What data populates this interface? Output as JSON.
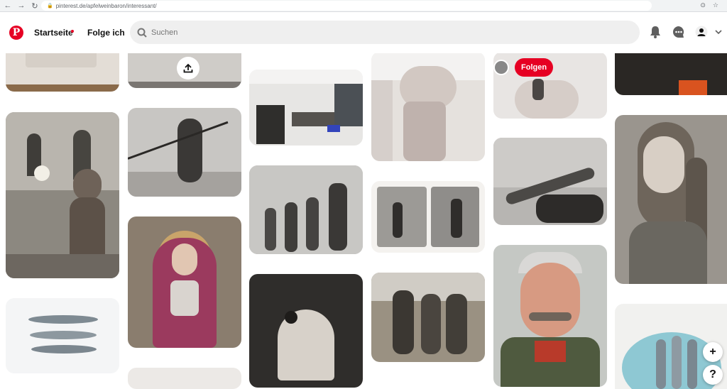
{
  "browser": {
    "url": "pinterest.de/apfelweinbaron/interessant/",
    "back_icon": "arrow-left-icon",
    "forward_icon": "arrow-right-icon",
    "reload_icon": "reload-icon"
  },
  "header": {
    "home_label": "Startseite",
    "following_label": "Folge ich",
    "search_placeholder": "Suchen"
  },
  "pin_overlay": {
    "follow_label": "Folgen"
  },
  "fabs": {
    "add_label": "+",
    "help_label": "?"
  },
  "colors": {
    "brand": "#e60023",
    "search_bg": "#efefef"
  }
}
